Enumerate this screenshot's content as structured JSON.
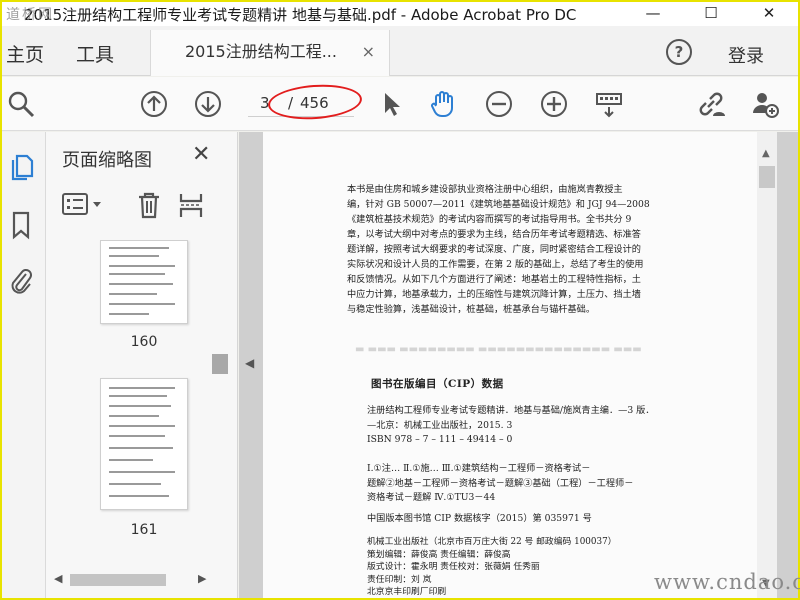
{
  "window": {
    "title": "2015注册结构工程师专业考试专题精讲 地基与基础.pdf - Adobe Acrobat Pro DC",
    "watermark_logo": "道桥网",
    "controls": {
      "minimize": "—",
      "maximize": "☐",
      "close": "✕"
    }
  },
  "tabs": {
    "home": "主页",
    "tools": "工具",
    "document": "2015注册结构工程...",
    "close": "×",
    "help": "?",
    "login": "登录"
  },
  "toolbar": {
    "current_page": "3",
    "page_separator": "/",
    "total_pages": "456",
    "icons": [
      "search-icon",
      "page-up-icon",
      "page-down-icon",
      "select-cursor-icon",
      "hand-tool-icon",
      "zoom-out-icon",
      "zoom-in-icon",
      "keyboard-icon",
      "share-link-icon",
      "add-user-icon"
    ],
    "annotation_color": "#e21d1d"
  },
  "left_rail": {
    "icons": [
      "page-thumbnails-icon",
      "bookmark-icon",
      "attachment-icon"
    ],
    "accent": "#2d7fd3"
  },
  "thumbnail_panel": {
    "title": "页面缩略图",
    "close": "✕",
    "pages": [
      {
        "label": "160"
      },
      {
        "label": "161"
      }
    ]
  },
  "document": {
    "intro": [
      "本书是由住房和城乡建设部执业资格注册中心组织，由施岚青教授主",
      "编，针对 GB 50007—2011《建筑地基基础设计规范》和 JGJ 94—2008",
      "《建筑桩基技术规范》的考试内容而撰写的考试指导用书。全书共分 9",
      "章，以考试大纲中对考点的要求为主线，结合历年考试考题精选、标准答",
      "题详解，按照考试大纲要求的考试深度、广度，同时紧密结合工程设计的",
      "实际状况和设计人员的工作需要，在第 2 版的基础上，总结了考生的使用",
      "和反馈情况。从如下几个方面进行了阐述：地基岩土的工程特性指标，土",
      "中应力计算，地基承载力，土的压缩性与建筑沉降计算，土压力、挡土墙",
      "与稳定性验算，浅基础设计，桩基础，桩基承台与锚杆基础。"
    ],
    "cip_title": "图书在版编目（CIP）数据",
    "cip_lines": [
      "注册结构工程师专业考试专题精讲．地基与基础/施岚青主编．—3 版．",
      "—北京：机械工业出版社，2015. 3",
      "ISBN 978 – 7 – 111 – 49414 – 0",
      "",
      "Ⅰ.①注…  Ⅱ.①施…  Ⅲ.①建筑结构－工程师－资格考试－",
      "题解②地基－工程师－资格考试－题解③基础（工程）－工程师－",
      "资格考试－题解  Ⅳ.①TU3－44"
    ],
    "cip_number": "中国版本图书馆 CIP 数据核字（2015）第 035971 号",
    "publisher_lines": [
      "机械工业出版社（北京市百万庄大街 22 号  邮政编码 100037）",
      "策划编辑：薛俊高  责任编辑：薛俊高",
      "版式设计：霍永明  责任校对：张薇娟  任秀丽",
      "责任印制：刘  岚",
      "北京京丰印刷厂印刷"
    ]
  },
  "corner_watermark": "www.cndao.com"
}
